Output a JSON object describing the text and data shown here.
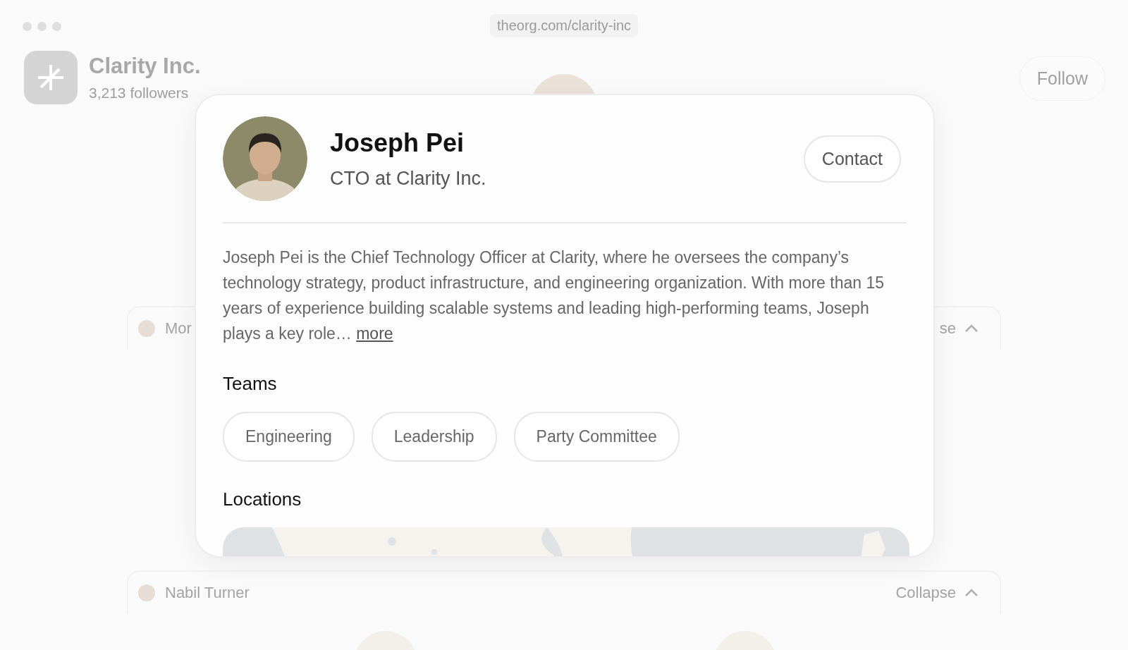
{
  "browser": {
    "url": "theorg.com/clarity-inc"
  },
  "company": {
    "name": "Clarity Inc.",
    "followers": "3,213 followers",
    "follow_button": "Follow"
  },
  "groups": [
    {
      "manager": "Mor",
      "toggle": "se"
    },
    {
      "manager": "Nabil Turner",
      "toggle": "Collapse"
    }
  ],
  "profile_card": {
    "name": "Joseph Pei",
    "title": "CTO at Clarity Inc.",
    "contact_button": "Contact",
    "bio": "Joseph Pei is the Chief Technology Officer at Clarity, where he oversees the company’s technology strategy, product infrastructure, and engineering organization. With more than 15 years of experience building scalable systems and leading high-performing teams, Joseph plays a key role…",
    "more_link": "more",
    "teams_heading": "Teams",
    "teams": [
      "Engineering",
      "Leadership",
      "Party Committee"
    ],
    "locations_heading": "Locations"
  }
}
